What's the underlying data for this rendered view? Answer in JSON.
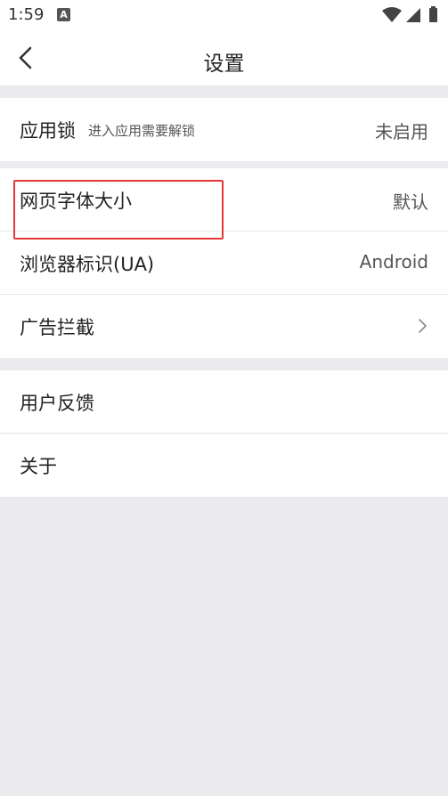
{
  "status": {
    "time": "1:59",
    "notif_letter": "A"
  },
  "header": {
    "title": "设置"
  },
  "groups": [
    {
      "rows": [
        {
          "label": "应用锁",
          "sub": "进入应用需要解锁",
          "value": "未启用"
        }
      ]
    },
    {
      "rows": [
        {
          "label": "网页字体大小",
          "value": "默认"
        },
        {
          "label": "浏览器标识(UA)",
          "value": "Android"
        },
        {
          "label": "广告拦截",
          "chevron": true
        }
      ]
    },
    {
      "rows": [
        {
          "label": "用户反馈"
        },
        {
          "label": "关于"
        }
      ]
    }
  ],
  "colors": {
    "background": "#ebebed",
    "card": "#ffffff",
    "highlight": "#e53935"
  },
  "icons": [
    "back-arrow-icon",
    "wifi-icon",
    "signal-icon",
    "battery-icon",
    "chevron-right-icon"
  ]
}
